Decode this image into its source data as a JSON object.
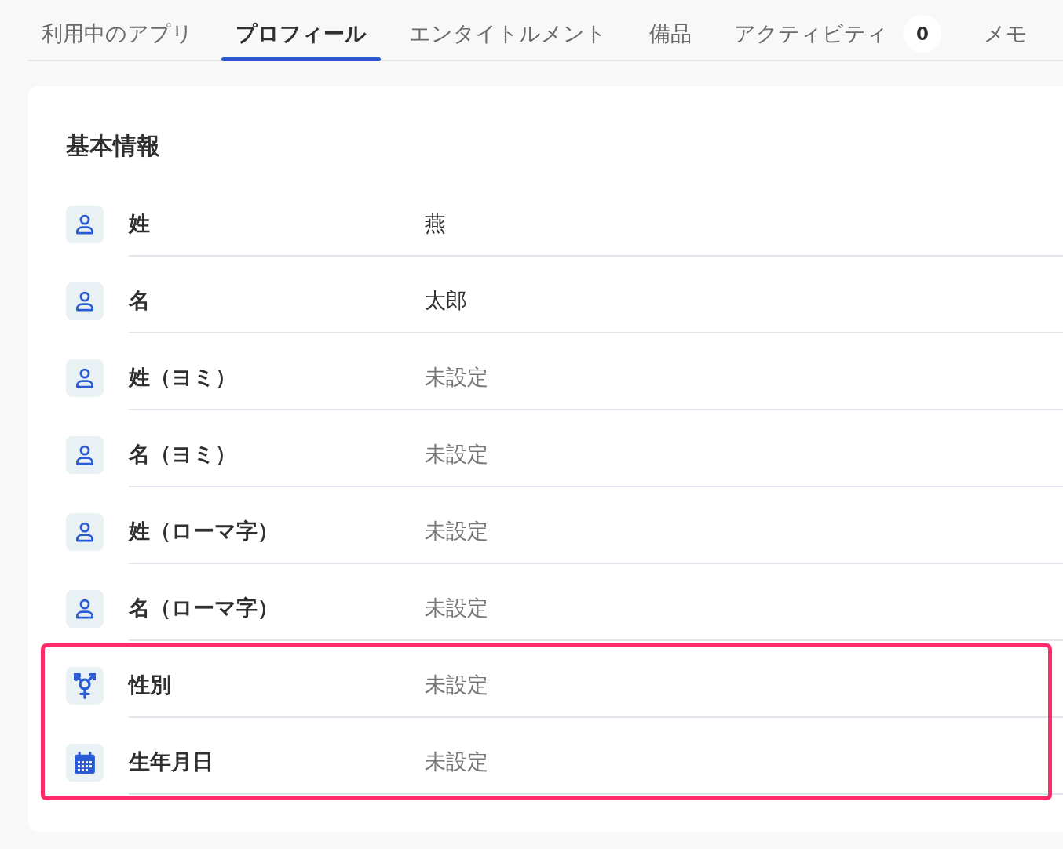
{
  "tabs": [
    {
      "label": "利用中のアプリ",
      "selected": false
    },
    {
      "label": "プロフィール",
      "selected": true
    },
    {
      "label": "エンタイトルメント",
      "selected": false
    },
    {
      "label": "備品",
      "selected": false
    },
    {
      "label": "アクティビティ",
      "selected": false,
      "badge": "0"
    },
    {
      "label": "メモ",
      "selected": false
    }
  ],
  "section": {
    "title": "基本情報",
    "rows": [
      {
        "kind": "name",
        "label": "姓",
        "value": "燕",
        "unset": false,
        "highlighted": false
      },
      {
        "kind": "name",
        "label": "名",
        "value": "太郎",
        "unset": false,
        "highlighted": false
      },
      {
        "kind": "name",
        "label": "姓（ヨミ）",
        "value": "未設定",
        "unset": true,
        "highlighted": false
      },
      {
        "kind": "name",
        "label": "名（ヨミ）",
        "value": "未設定",
        "unset": true,
        "highlighted": false
      },
      {
        "kind": "name",
        "label": "姓（ローマ字）",
        "value": "未設定",
        "unset": true,
        "highlighted": false
      },
      {
        "kind": "name",
        "label": "名（ローマ字）",
        "value": "未設定",
        "unset": true,
        "highlighted": false
      },
      {
        "kind": "gender",
        "label": "性別",
        "value": "未設定",
        "unset": true,
        "highlighted": true
      },
      {
        "kind": "date",
        "label": "生年月日",
        "value": "未設定",
        "unset": true,
        "highlighted": true
      }
    ]
  }
}
